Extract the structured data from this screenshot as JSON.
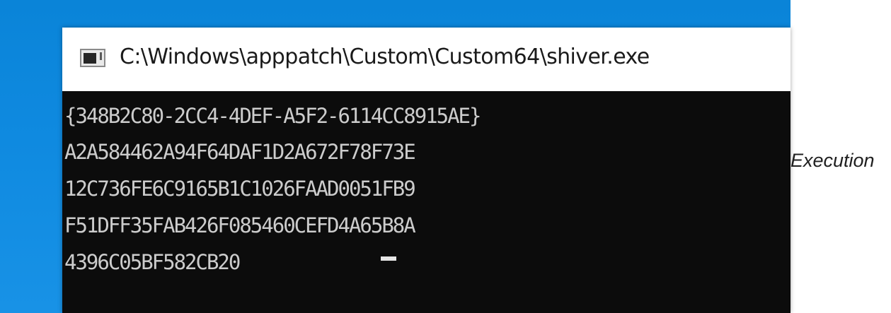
{
  "window": {
    "title": "C:\\Windows\\apppatch\\Custom\\Custom64\\shiver.exe",
    "icon": "console-window-icon"
  },
  "console": {
    "lines": [
      "{348B2C80-2CC4-4DEF-A5F2-6114CC8915AE}",
      "A2A584462A94F64DAF1D2A672F78F73E",
      "12C736FE6C9165B1C1026FAAD0051FB9",
      "F51DFF35FAB426F085460CEFD4A65B8A",
      "4396C05BF582CB20"
    ]
  },
  "caption": {
    "text": "Execution"
  },
  "colors": {
    "desktop": "#0f8ae0",
    "console_bg": "#0c0c0c",
    "console_text": "#cccccc",
    "title_bar": "#ffffff"
  }
}
